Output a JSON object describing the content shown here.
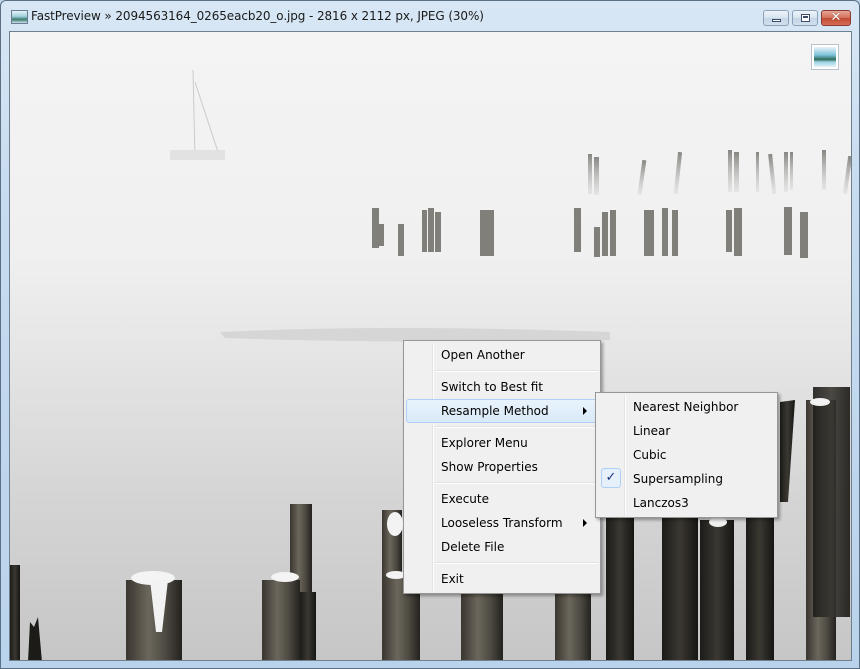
{
  "window": {
    "title": "FastPreview » 2094563164_0265eacb20_o.jpg - 2816 x 2112 px, JPEG (30%)",
    "app_icon": "image-icon",
    "buttons": {
      "minimize": "minimize-icon",
      "maximize": "maximize-icon",
      "close_glyph": "✕"
    }
  },
  "viewer": {
    "image_description": "Foggy harbor with old wooden pier pilings, snow-capped posts in foreground, sailboat in mist",
    "corner_button_icon": "picture-icon"
  },
  "context_menu": {
    "items": [
      {
        "label": "Open Another",
        "type": "item"
      },
      {
        "type": "separator"
      },
      {
        "label": "Switch to Best fit",
        "type": "item"
      },
      {
        "label": "Resample Method",
        "type": "submenu",
        "highlighted": true
      },
      {
        "type": "separator"
      },
      {
        "label": "Explorer Menu",
        "type": "item"
      },
      {
        "label": "Show Properties",
        "type": "item"
      },
      {
        "type": "separator"
      },
      {
        "label": "Execute",
        "type": "item"
      },
      {
        "label": "Looseless Transform",
        "type": "submenu"
      },
      {
        "label": "Delete File",
        "type": "item"
      },
      {
        "type": "separator"
      },
      {
        "label": "Exit",
        "type": "item"
      }
    ]
  },
  "resample_submenu": {
    "items": [
      {
        "label": "Nearest Neighbor",
        "checked": false
      },
      {
        "label": "Linear",
        "checked": false
      },
      {
        "label": "Cubic",
        "checked": false
      },
      {
        "label": "Supersampling",
        "checked": true
      },
      {
        "label": "Lanczos3",
        "checked": false
      }
    ],
    "check_glyph": "✓"
  }
}
